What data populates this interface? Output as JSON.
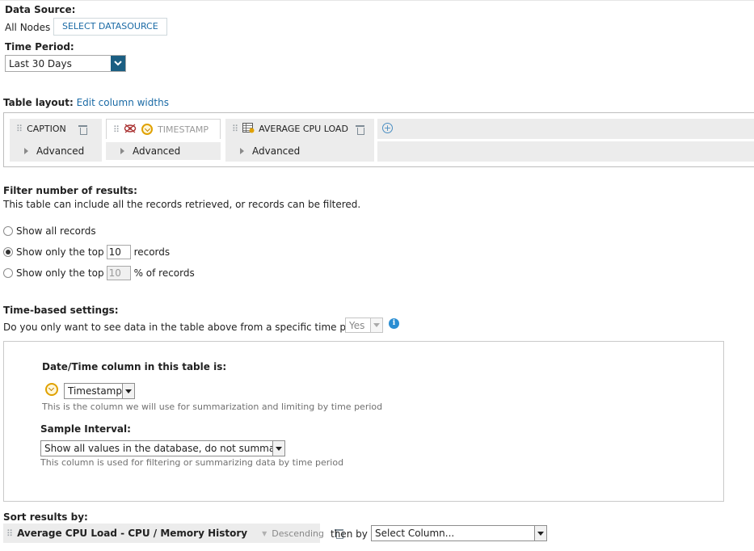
{
  "data_source": {
    "label": "Data Source:",
    "value": "All Nodes",
    "select_button": "SELECT DATASOURCE"
  },
  "time_period": {
    "label": "Time Period:",
    "selected": "Last 30 Days"
  },
  "table_layout": {
    "label": "Table layout:",
    "edit_link": "Edit column widths",
    "columns": [
      {
        "name": "CAPTION",
        "advanced": "Advanced"
      },
      {
        "name": "TIMESTAMP",
        "advanced": "Advanced"
      },
      {
        "name": "AVERAGE CPU LOAD",
        "advanced": "Advanced"
      }
    ]
  },
  "filter": {
    "title": "Filter number of results:",
    "description": "This table can include all the records retrieved, or records can be filtered.",
    "options": {
      "all": "Show all records",
      "top_prefix": "Show only the top",
      "top_value": "10",
      "top_suffix": "records",
      "pct_prefix": "Show only the top",
      "pct_value": "10",
      "pct_suffix": "% of records"
    },
    "selected": "top"
  },
  "time_settings": {
    "title": "Time-based settings:",
    "question": "Do you only want to see data in the table above from a specific time period?",
    "answer": "Yes",
    "datetime_label": "Date/Time column in this table is:",
    "datetime_value": "Timestamp",
    "datetime_note": "This is the column we will use for summarization and limiting by time period",
    "interval_label": "Sample Interval:",
    "interval_value": "Show all values in the database, do not summarize",
    "interval_note": "This column is used for filtering or summarizing data by time period"
  },
  "sort": {
    "label": "Sort results by:",
    "column": "Average CPU Load - CPU / Memory History",
    "direction": "Descending",
    "then_by_label": "then by",
    "then_by_value": "Select Column..."
  },
  "colors": {
    "link": "#1a6aa5",
    "select_arrow_bg": "#1b5e82",
    "column_bg": "#ececec",
    "info": "#2a8ed3",
    "clock": "#e0a100"
  },
  "icons": [
    "trash-icon",
    "clock-icon",
    "hidden-eye-icon",
    "table-icon",
    "add-icon",
    "info-icon",
    "drag-handle-icon"
  ]
}
